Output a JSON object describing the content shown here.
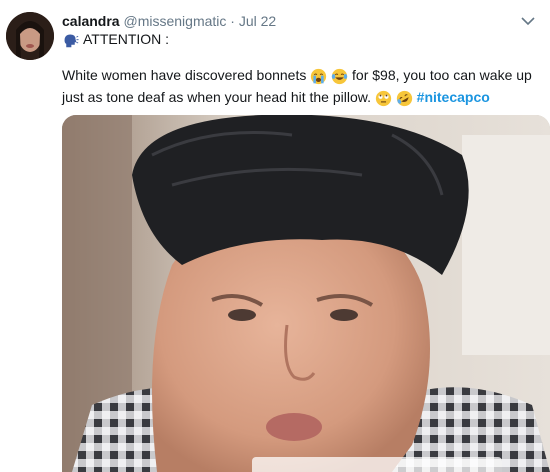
{
  "tweet": {
    "display_name": "calandra",
    "handle": "@missenigmatic",
    "separator": "·",
    "date": "Jul 22",
    "attention_label": "ATTENTION :",
    "text_part1": "White women have discovered bonnets ",
    "text_part2": " for $98, you too can wake up just as tone deaf as when your head hit the pillow. ",
    "hashtag": "#nitecapco",
    "icons": {
      "speaking_head": "speaking-head-icon",
      "crying": "loudly-crying-face-icon",
      "laughing": "face-with-tears-of-joy-icon",
      "rolling_eyes": "face-with-rolling-eyes-icon",
      "rofl": "rolling-on-floor-laughing-icon",
      "menu": "chevron-down-icon"
    }
  },
  "colors": {
    "text": "#14171a",
    "muted": "#657786",
    "link": "#1b95e0"
  }
}
